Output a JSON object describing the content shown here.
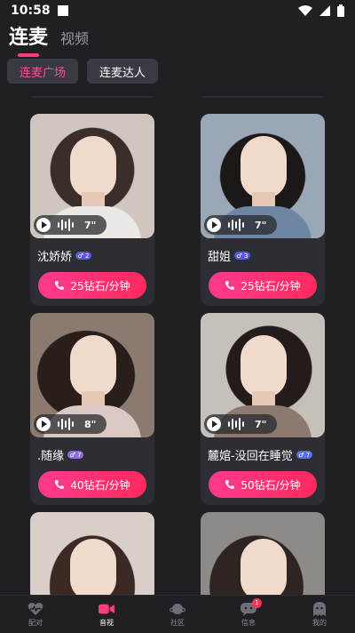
{
  "status": {
    "time": "10:58"
  },
  "header": {
    "tabs": [
      {
        "label": "连麦"
      },
      {
        "label": "视频"
      }
    ]
  },
  "subtabs": [
    {
      "label": "连麦广场"
    },
    {
      "label": "连麦达人"
    }
  ],
  "cards": [
    {
      "name": "沈娇娇",
      "badge": "♂ 2",
      "duration": "7\"",
      "price": "25钻石/分钟"
    },
    {
      "name": "甜姐",
      "badge": "♂ 3",
      "duration": "7\"",
      "price": "25钻石/分钟"
    },
    {
      "name": ".随缘",
      "badge": "♂ 7",
      "duration": "8\"",
      "price": "40钻石/分钟"
    },
    {
      "name": "麓婠-没回在睡觉",
      "badge": "♂ 7",
      "duration": "7\"",
      "price": "50钻石/分钟"
    }
  ],
  "nav": [
    {
      "label": "配对",
      "icon": "heart-pulse-icon"
    },
    {
      "label": "音视",
      "icon": "video-camera-icon"
    },
    {
      "label": "社区",
      "icon": "planet-icon"
    },
    {
      "label": "信息",
      "icon": "chat-bubble-icon",
      "badge": "1"
    },
    {
      "label": "我的",
      "icon": "ghost-profile-icon"
    }
  ],
  "colors": {
    "accent": "#ff3b7f",
    "background": "#1f1f24",
    "card": "#2d2d33"
  }
}
